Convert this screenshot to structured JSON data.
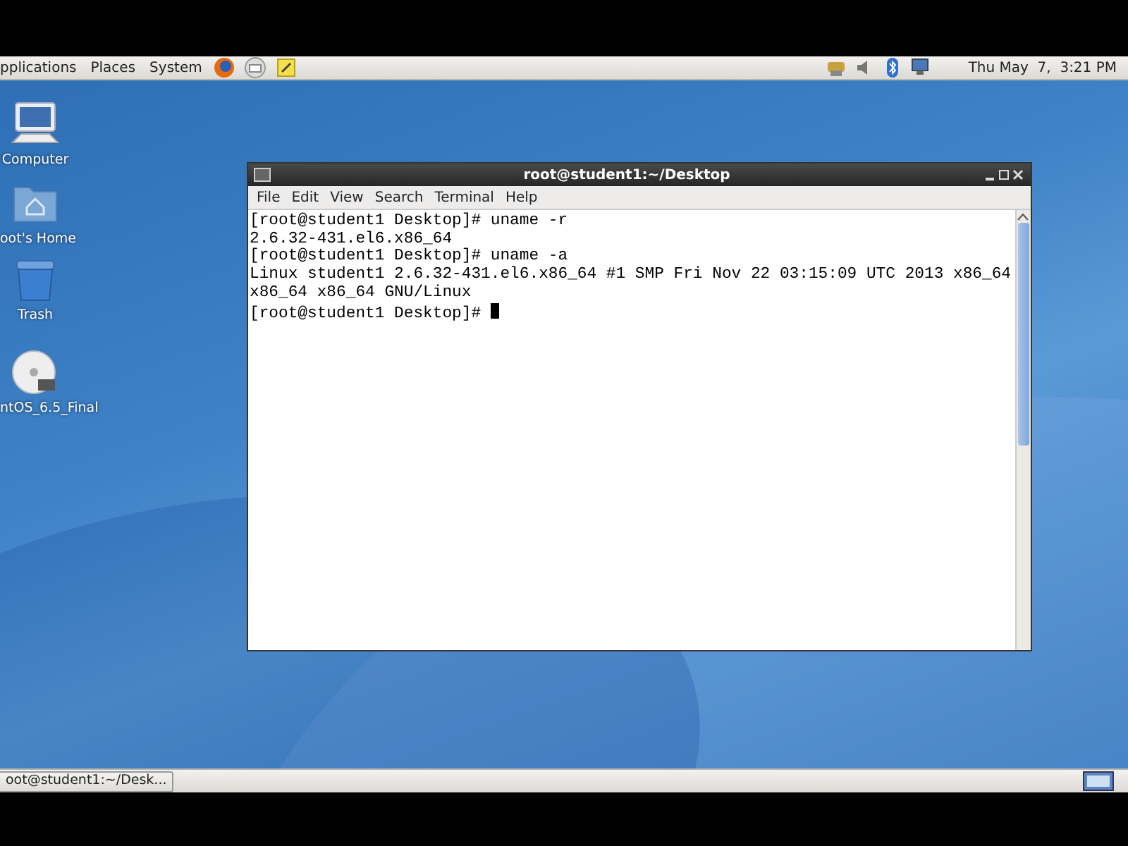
{
  "top_panel": {
    "menus": [
      "pplications",
      "Places",
      "System"
    ],
    "launchers": [
      {
        "kind": "browser"
      },
      {
        "kind": "mail"
      },
      {
        "kind": "notes"
      }
    ],
    "tray": [
      {
        "kind": "network"
      },
      {
        "kind": "volume"
      },
      {
        "kind": "bluetooth"
      },
      {
        "kind": "display"
      }
    ],
    "clock": "Thu May  7,  3:21 PM"
  },
  "desktop_icons": [
    {
      "label": "Computer",
      "kind": "computer"
    },
    {
      "label": "oot's Home",
      "kind": "home"
    },
    {
      "label": "Trash",
      "kind": "trash"
    },
    {
      "label": "ntOS_6.5_Final",
      "kind": "disc"
    }
  ],
  "terminal": {
    "title": "root@student1:~/Desktop",
    "menu": [
      "File",
      "Edit",
      "View",
      "Search",
      "Terminal",
      "Help"
    ],
    "lines": [
      "[root@student1 Desktop]# uname -r",
      "2.6.32-431.el6.x86_64",
      "[root@student1 Desktop]# uname -a",
      "Linux student1 2.6.32-431.el6.x86_64 #1 SMP Fri Nov 22 03:15:09 UTC 2013 x86_64",
      "x86_64 x86_64 GNU/Linux",
      "[root@student1 Desktop]# "
    ]
  },
  "taskbar": {
    "items": [
      {
        "label": "oot@student1:~/Desk...",
        "selected": false
      }
    ]
  }
}
